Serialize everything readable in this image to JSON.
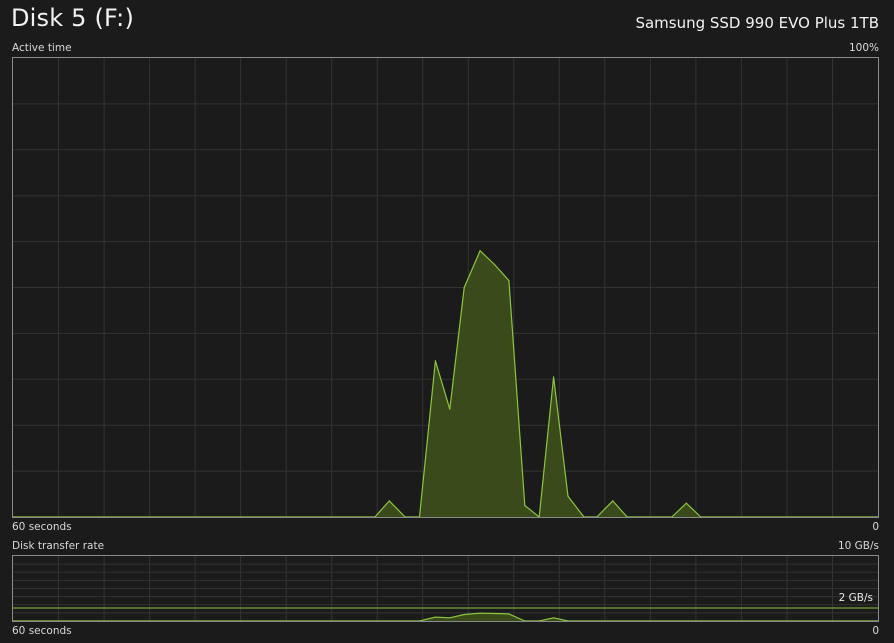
{
  "header": {
    "title": "Disk 5 (F:)",
    "model": "Samsung SSD 990 EVO Plus 1TB"
  },
  "active_time": {
    "label": "Active time",
    "max_label": "100%",
    "time_span_label": "60 seconds",
    "min_label": "0"
  },
  "transfer_rate": {
    "label": "Disk transfer rate",
    "max_label": "10 GB/s",
    "time_span_label": "60 seconds",
    "min_label": "0",
    "marker_label": "2 GB/s"
  },
  "colors": {
    "line": "#8cc63f",
    "fill": "#3a4a1a",
    "grid": "#333333",
    "border": "#8a8a8a"
  },
  "chart_data": [
    {
      "type": "area",
      "ylabel": "Active time",
      "ylim": [
        0,
        100
      ],
      "xlim": [
        60,
        0
      ],
      "grid": true,
      "x": [
        60,
        34.9,
        33.9,
        32.8,
        31.8,
        30.7,
        29.7,
        28.7,
        27.6,
        26.6,
        25.6,
        24.5,
        23.5,
        22.5,
        21.5,
        20.4,
        19.5,
        18.4,
        17.4,
        16.4,
        15.4,
        14.3,
        13.3,
        12.3,
        10.5,
        9.5,
        0
      ],
      "values": [
        0,
        0,
        3.5,
        0,
        0,
        34,
        23.5,
        50,
        58,
        55,
        51.5,
        2.5,
        0,
        30.5,
        4.5,
        0,
        0,
        3.5,
        0,
        0,
        0,
        0,
        3,
        0,
        0,
        0,
        0
      ]
    },
    {
      "type": "area",
      "ylabel": "Disk transfer rate",
      "ylim": [
        0,
        10
      ],
      "xlim": [
        60,
        0
      ],
      "grid": true,
      "reference_line": 2,
      "x": [
        60,
        31.8,
        30.7,
        29.7,
        28.7,
        27.6,
        26.6,
        25.6,
        24.5,
        23.5,
        22.5,
        21.5,
        20.4,
        0
      ],
      "values": [
        0,
        0,
        0.6,
        0.5,
        1.0,
        1.2,
        1.15,
        1.1,
        0,
        0,
        0.5,
        0,
        0,
        0
      ]
    }
  ]
}
